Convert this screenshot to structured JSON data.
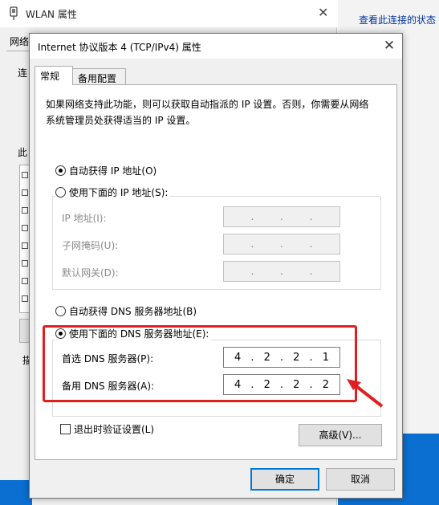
{
  "background_window": {
    "title": "WLAN 属性",
    "close_glyph": "✕",
    "tab_networking": "网络",
    "label_connect": "连",
    "label_this": "此",
    "label_bottom": "描",
    "right_link": "查看此连接的状态"
  },
  "dialog": {
    "title": "Internet 协议版本 4 (TCP/IPv4) 属性",
    "close_glyph": "✕",
    "tabs": [
      {
        "label": "常规"
      },
      {
        "label": "备用配置"
      }
    ],
    "description": "如果网络支持此功能，则可以获取自动指派的 IP 设置。否则，你需要从网络系统管理员处获得适当的 IP 设置。",
    "ip": {
      "auto_label": "自动获得 IP 地址(O)",
      "manual_label": "使用下面的 IP 地址(S):",
      "auto_selected": true,
      "fields": [
        {
          "label": "IP 地址(I):",
          "octets": [
            "",
            "",
            "",
            ""
          ]
        },
        {
          "label": "子网掩码(U):",
          "octets": [
            "",
            "",
            "",
            ""
          ]
        },
        {
          "label": "默认网关(D):",
          "octets": [
            "",
            "",
            "",
            ""
          ]
        }
      ]
    },
    "dns": {
      "auto_label": "自动获得 DNS 服务器地址(B)",
      "manual_label": "使用下面的 DNS 服务器地址(E):",
      "manual_selected": true,
      "preferred": {
        "label": "首选 DNS 服务器(P):",
        "octets": [
          "4",
          "2",
          "2",
          "1"
        ]
      },
      "alternate": {
        "label": "备用 DNS 服务器(A):",
        "octets": [
          "4",
          "2",
          "2",
          "2"
        ]
      }
    },
    "validate_label": "退出时验证设置(L)",
    "validate_checked": false,
    "advanced_label": "高级(V)...",
    "ok_label": "确定",
    "cancel_label": "取消"
  },
  "colors": {
    "annotation_red": "#e02020",
    "focus_blue": "#0078d7",
    "taskbar_blue": "#0a6fd1"
  }
}
